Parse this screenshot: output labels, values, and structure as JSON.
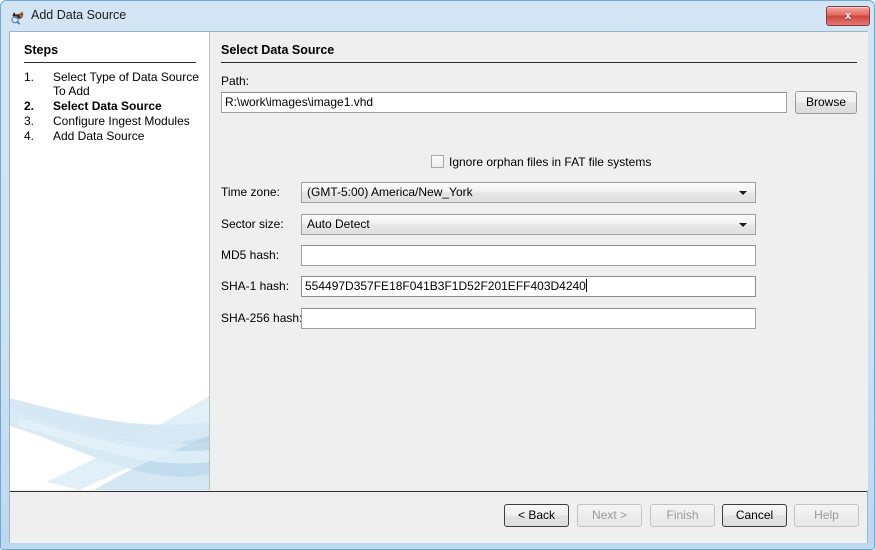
{
  "window": {
    "title": "Add Data Source",
    "icon": "autopsy-dog-icon",
    "close_label": "x"
  },
  "steps": {
    "heading": "Steps",
    "items": [
      {
        "number": "1.",
        "label": "Select Type of Data Source To Add",
        "current": false
      },
      {
        "number": "2.",
        "label": "Select Data Source",
        "current": true
      },
      {
        "number": "3.",
        "label": "Configure Ingest Modules",
        "current": false
      },
      {
        "number": "4.",
        "label": "Add Data Source",
        "current": false
      }
    ]
  },
  "content": {
    "heading": "Select Data Source",
    "path": {
      "label": "Path:",
      "value": "R:\\work\\images\\image1.vhd",
      "browse_label": "Browse"
    },
    "ignore_orphan": {
      "label": "Ignore orphan files in FAT file systems",
      "checked": false
    },
    "timezone": {
      "label": "Time zone:",
      "value": "(GMT-5:00) America/New_York"
    },
    "sector_size": {
      "label": "Sector size:",
      "value": "Auto Detect"
    },
    "md5": {
      "label": "MD5 hash:",
      "value": ""
    },
    "sha1": {
      "label": "SHA-1 hash:",
      "value": "554497D357FE18F041B3F1D52F201EFF403D4240"
    },
    "sha256": {
      "label": "SHA-256 hash:",
      "value": ""
    }
  },
  "buttons": {
    "back": {
      "label": "< Back",
      "enabled": true
    },
    "next": {
      "label": "Next >",
      "enabled": false
    },
    "finish": {
      "label": "Finish",
      "enabled": false
    },
    "cancel": {
      "label": "Cancel",
      "enabled": true
    },
    "help": {
      "label": "Help",
      "enabled": false
    }
  },
  "colors": {
    "titlebar": "#cfe2f3",
    "panel": "#efefef",
    "accent": "#b7d6e8",
    "close_button": "#d0453c"
  }
}
